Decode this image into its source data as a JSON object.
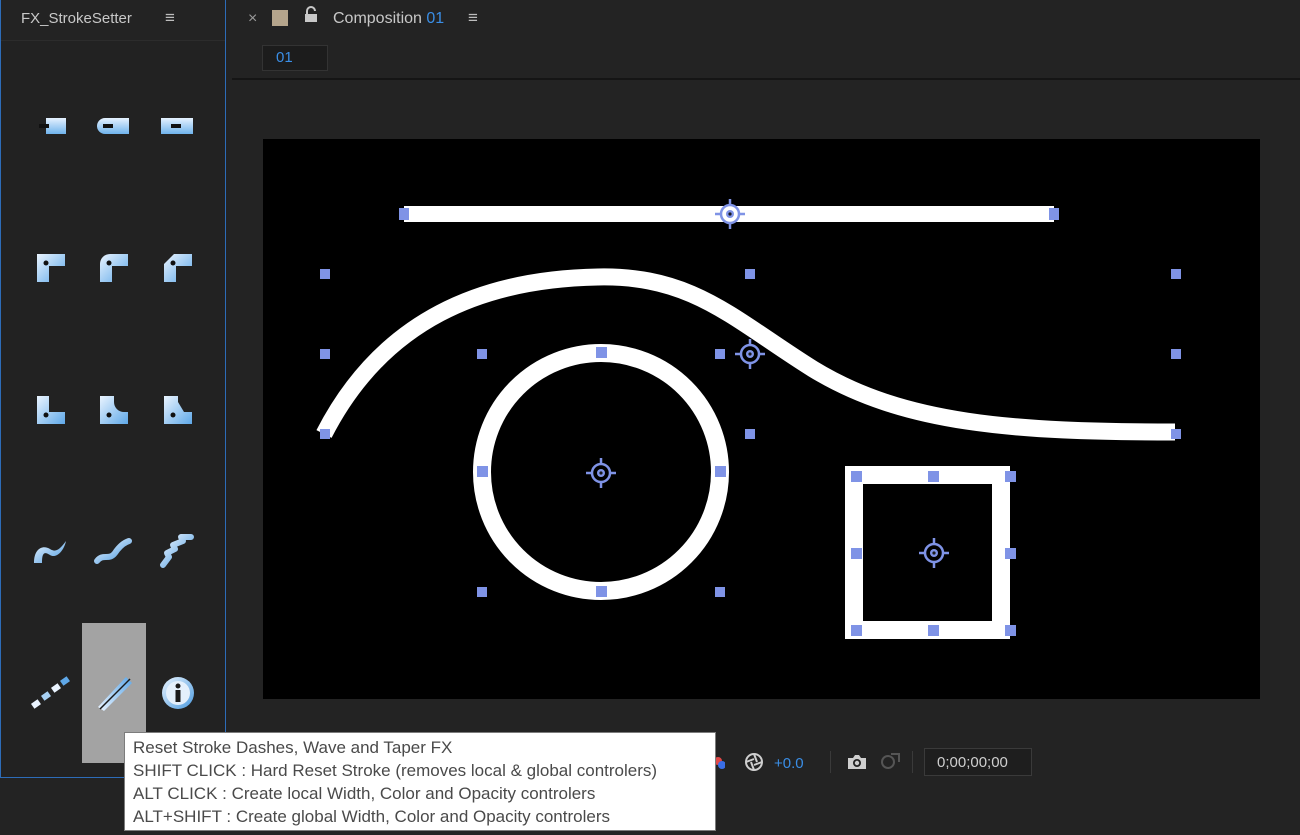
{
  "left_panel": {
    "title": "FX_StrokeSetter",
    "menu_icon": "hamburger-icon",
    "tools": [
      {
        "icon": "cap-butt-icon"
      },
      {
        "icon": "cap-round-icon"
      },
      {
        "icon": "cap-square-icon"
      },
      {
        "icon": "join-miter-icon"
      },
      {
        "icon": "join-round-icon"
      },
      {
        "icon": "join-bevel-icon"
      },
      {
        "icon": "inner-miter-icon"
      },
      {
        "icon": "inner-round-icon"
      },
      {
        "icon": "inner-bevel-icon"
      },
      {
        "icon": "taper-stroke-icon"
      },
      {
        "icon": "wave-stroke-icon"
      },
      {
        "icon": "zigzag-stroke-icon"
      },
      {
        "icon": "dashes-icon"
      },
      {
        "icon": "reset-stroke-icon",
        "active": true
      },
      {
        "icon": "info-icon"
      }
    ]
  },
  "composition": {
    "close_label": "×",
    "title": "Composition",
    "title_number": "01",
    "tab_badge": "01"
  },
  "viewer_bar": {
    "exposure": "+0.0",
    "timecode": "0;00;00;00"
  },
  "tooltip": {
    "lines": [
      "Reset Stroke Dashes, Wave and Taper FX",
      "SHIFT CLICK : Hard Reset Stroke (removes local & global controlers)",
      "ALT CLICK : Create local Width, Color and Opacity controlers",
      "ALT+SHIFT : Create global Width, Color and Opacity controlers"
    ]
  },
  "colors": {
    "accent": "#3a8ee6",
    "handle": "#7f93e6",
    "panel_bg": "#232323",
    "canvas_bg": "#000000",
    "stroke": "#ffffff"
  }
}
